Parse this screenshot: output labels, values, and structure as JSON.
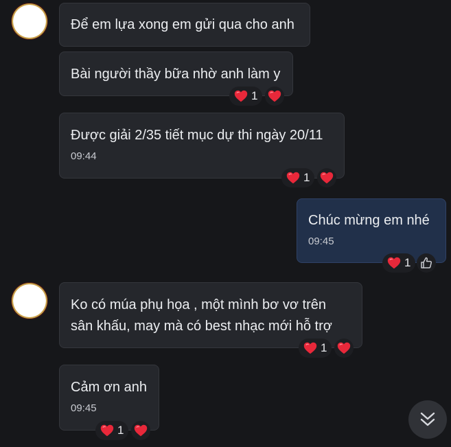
{
  "colors": {
    "background": "#16171a",
    "incoming_bubble": "#25272c",
    "outgoing_bubble": "#21304a",
    "heart": "#e8283a"
  },
  "messages": [
    {
      "text": "Để em lựa xong em gửi qua cho anh"
    },
    {
      "text": "Bài người thầy bữa nhờ anh làm y",
      "reaction": {
        "icon": "heart-icon",
        "count": "1"
      }
    },
    {
      "text": "Được giải 2/35 tiết mục dự thi ngày 20/11",
      "time": "09:44",
      "reaction": {
        "icon": "heart-icon",
        "count": "1"
      }
    },
    {
      "text": "Chúc mừng em nhé",
      "time": "09:45",
      "reaction": {
        "icon": "heart-icon",
        "count": "1"
      },
      "own": true
    },
    {
      "text_lines": [
        "Ko có múa phụ họa , một mình bơ vơ trên",
        "sân khấu, may mà có best nhạc mới hỗ trợ"
      ],
      "reaction": {
        "icon": "heart-icon",
        "count": "1"
      }
    },
    {
      "text": "Cảm ơn anh",
      "time": "09:45",
      "reaction": {
        "icon": "heart-icon",
        "count": "1"
      }
    }
  ],
  "icons": {
    "react_button_incoming": "heart-icon",
    "react_button_own": "thumbs-up-icon",
    "scroll_down": "double-chevron-down-icon"
  }
}
